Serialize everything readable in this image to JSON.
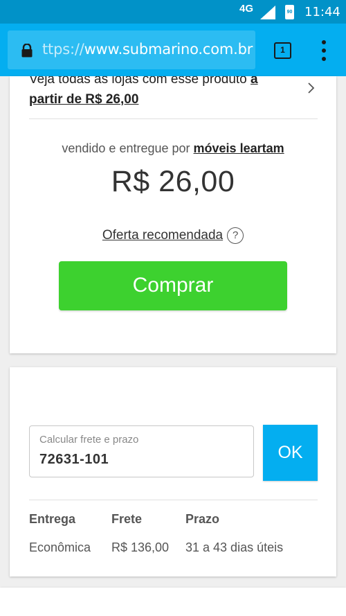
{
  "status_bar": {
    "network": "4G",
    "battery": "90",
    "time": "11:44"
  },
  "browser": {
    "url_scheme": "ttps://",
    "url_host": "www.submarino.com.br",
    "tab_count": "1"
  },
  "offer": {
    "all_stores_text": "Veja todas as lojas com esse produto ",
    "all_stores_link": "a partir de R$ 26,00",
    "sold_by_prefix": "vendido e entregue por ",
    "seller": "móveis leartam",
    "price": "R$ 26,00",
    "recommended_label": "Oferta recomendada",
    "help_glyph": "?",
    "buy_label": "Comprar"
  },
  "shipping": {
    "cep_label": "Calcular frete e prazo",
    "cep_value": "72631-101",
    "ok_label": "OK",
    "columns": [
      "Entrega",
      "Frete",
      "Prazo"
    ],
    "rows": [
      [
        "Econômica",
        "R$ 136,00",
        "31 a 43 dias úteis"
      ]
    ]
  },
  "colors": {
    "status_bar": "#0192c8",
    "toolbar": "#04aef0",
    "buy_button": "#3dd12f",
    "ok_button": "#04aef0"
  },
  "icons": [
    "lock-icon",
    "chevron-right-icon",
    "help-icon",
    "signal-icon",
    "battery-icon",
    "more-vert-icon"
  ]
}
